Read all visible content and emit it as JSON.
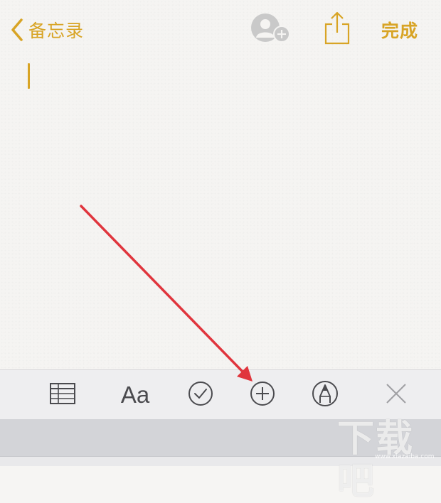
{
  "nav": {
    "back_label": "备忘录",
    "done_label": "完成"
  },
  "icons": {
    "back": "chevron-left-icon",
    "collaborate": "add-person-icon",
    "share": "share-icon",
    "table": "table-icon",
    "format": "text-format-icon",
    "checklist": "checklist-icon",
    "add": "plus-circle-icon",
    "markup": "markup-pen-icon",
    "close": "close-icon"
  },
  "toolbar": {
    "format_label": "Aa"
  },
  "watermark": {
    "text": "下载吧",
    "url": "www.xiazaiba.com"
  },
  "colors": {
    "accent": "#d8a425",
    "annotation_arrow": "#e0353d",
    "toolbar_bg": "#eeeef0",
    "icon_gray": "#4b4b4f"
  }
}
